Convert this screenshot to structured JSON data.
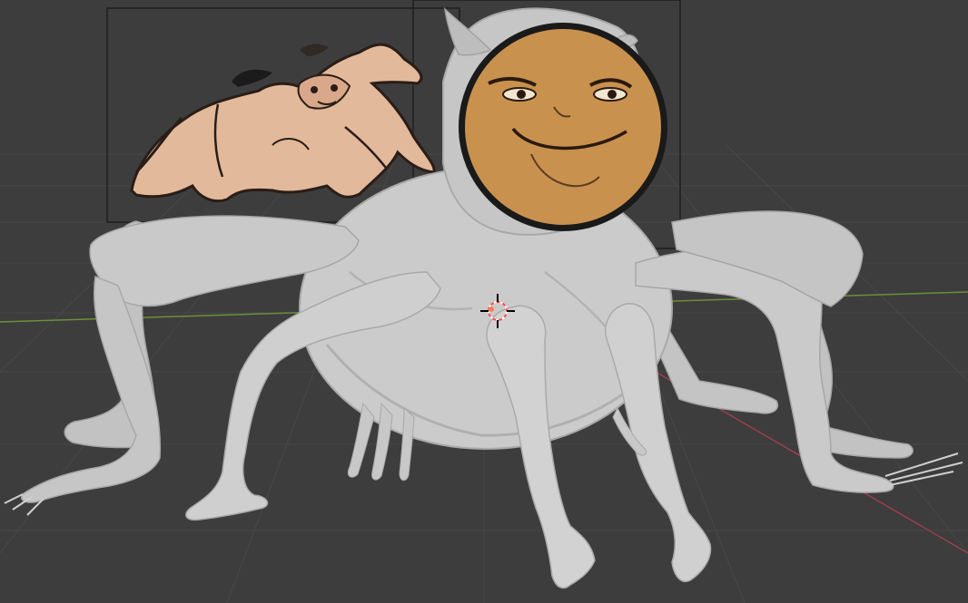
{
  "app": {
    "name": "3D viewport",
    "viewport_background": "#3d3d3d"
  },
  "scene": {
    "model": {
      "type": "sculpted creature mesh",
      "material_color": "#c9c9c9",
      "legs_visible": 10
    },
    "reference_images": [
      {
        "kind": "concept-sketch",
        "description_color": "#e2b99a"
      },
      {
        "kind": "face-decal",
        "description_color": "#c9914e"
      }
    ],
    "cursor": {
      "type": "3d-cursor",
      "colors": [
        "#ffffff",
        "#ff4a4a"
      ]
    }
  }
}
